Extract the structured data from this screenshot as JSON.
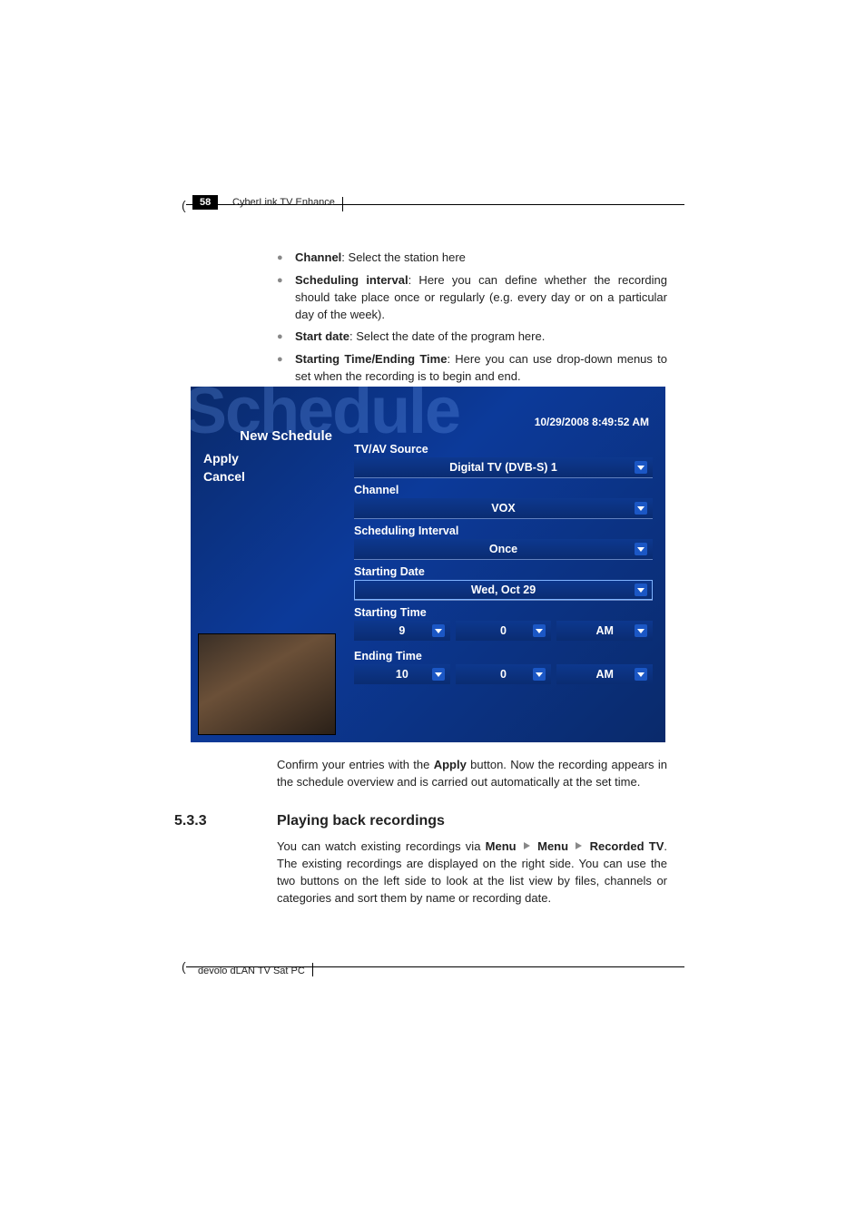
{
  "header": {
    "page_number": "58",
    "chapter": "CyberLink TV Enhance"
  },
  "bullets": {
    "channel_label": "Channel",
    "channel_text": ": Select the station here",
    "interval_label": "Scheduling interval",
    "interval_text": ": Here you can define whether the recording should take place once or regularly (e.g. every day or on a particular day of the week).",
    "startdate_label": "Start date",
    "startdate_text": ": Select the date of the program here.",
    "times_label": "Starting Time/Ending Time",
    "times_text": ": Here you can use drop-down menus to set when the recording is to begin and end."
  },
  "app": {
    "bg_word": "Schedule",
    "timestamp": "10/29/2008 8:49:52 AM",
    "new_schedule": "New Schedule",
    "apply": "Apply",
    "cancel": "Cancel",
    "fields": {
      "source_label": "TV/AV Source",
      "source_value": "Digital TV (DVB-S) 1",
      "channel_label": "Channel",
      "channel_value": "VOX",
      "interval_label": "Scheduling Interval",
      "interval_value": "Once",
      "startdate_label": "Starting Date",
      "startdate_value": "Wed, Oct 29",
      "starttime_label": "Starting Time",
      "starttime_h": "9",
      "starttime_m": "0",
      "starttime_ampm": "AM",
      "endtime_label": "Ending Time",
      "endtime_h": "10",
      "endtime_m": "0",
      "endtime_ampm": "AM"
    }
  },
  "confirm": {
    "pre": "Confirm your entries with the ",
    "apply_word": "Apply",
    "post": " button. Now the recording appears in the schedule overview and is carried out automatically at the set time."
  },
  "section": {
    "num": "5.3.3",
    "title": "Playing back recordings",
    "body_pre": "You can watch existing recordings via ",
    "menu1": "Menu",
    "menu2": "Menu",
    "menu3": "Recorded TV",
    "body_post": ". The existing recordings are displayed on the right side. You can use the two buttons on the left side to look at the list view by files, channels or categories and sort them by name or recording date."
  },
  "footer": {
    "product": "devolo dLAN TV Sat PC"
  }
}
